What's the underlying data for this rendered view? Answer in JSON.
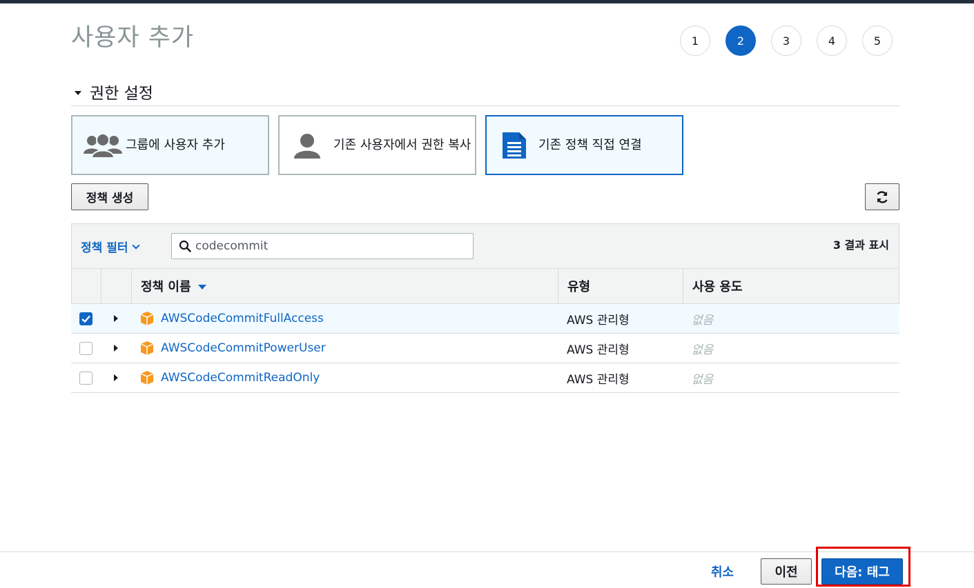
{
  "page": {
    "title": "사용자 추가"
  },
  "steps": [
    "1",
    "2",
    "3",
    "4",
    "5"
  ],
  "active_step": 2,
  "section": {
    "title": "권한 설정"
  },
  "options": [
    {
      "label": "그룹에 사용자 추가",
      "icon": "users-group-icon"
    },
    {
      "label": "기존 사용자에서 권한 복사",
      "icon": "user-icon"
    },
    {
      "label": "기존 정책 직접 연결",
      "icon": "document-icon"
    }
  ],
  "toolbar": {
    "create_policy_label": "정책 생성",
    "refresh_icon": "refresh-icon"
  },
  "filter": {
    "toggle_label": "정책 필터",
    "search_value": "codecommit",
    "result_count": "3 결과 표시"
  },
  "table": {
    "headers": {
      "name": "정책 이름",
      "type": "유형",
      "usage": "사용 용도"
    },
    "rows": [
      {
        "name": "AWSCodeCommitFullAccess",
        "type": "AWS 관리형",
        "usage": "없음",
        "checked": true
      },
      {
        "name": "AWSCodeCommitPowerUser",
        "type": "AWS 관리형",
        "usage": "없음",
        "checked": false
      },
      {
        "name": "AWSCodeCommitReadOnly",
        "type": "AWS 관리형",
        "usage": "없음",
        "checked": false
      }
    ]
  },
  "footer": {
    "cancel_label": "취소",
    "prev_label": "이전",
    "next_label": "다음: 태그"
  },
  "colors": {
    "accent": "#0f66c4",
    "highlight": "#e50000",
    "muted": "#879596"
  }
}
